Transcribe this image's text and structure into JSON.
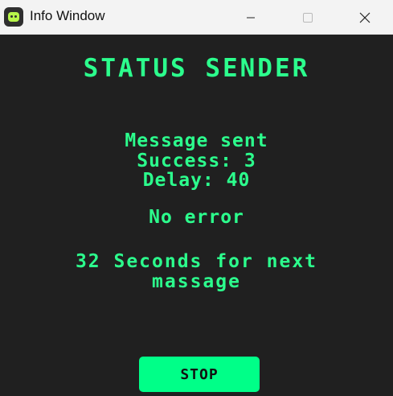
{
  "window": {
    "title": "Info Window",
    "icons": {
      "app": "app-chat-icon",
      "minimize": "minimize-icon",
      "maximize": "maximize-icon",
      "close": "close-icon"
    }
  },
  "status": {
    "title": "STATUS SENDER",
    "message": "Message sent",
    "success": "Success: 3",
    "delay": "Delay: 40",
    "error": "No error",
    "next_line_1": "32 Seconds for next",
    "next_line_2": "massage"
  },
  "button": {
    "stop_label": "STOP"
  },
  "colors": {
    "background": "#202020",
    "titlebar": "#f3f3f3",
    "text_accent": "#2cff8d",
    "button": "#00ff88"
  }
}
